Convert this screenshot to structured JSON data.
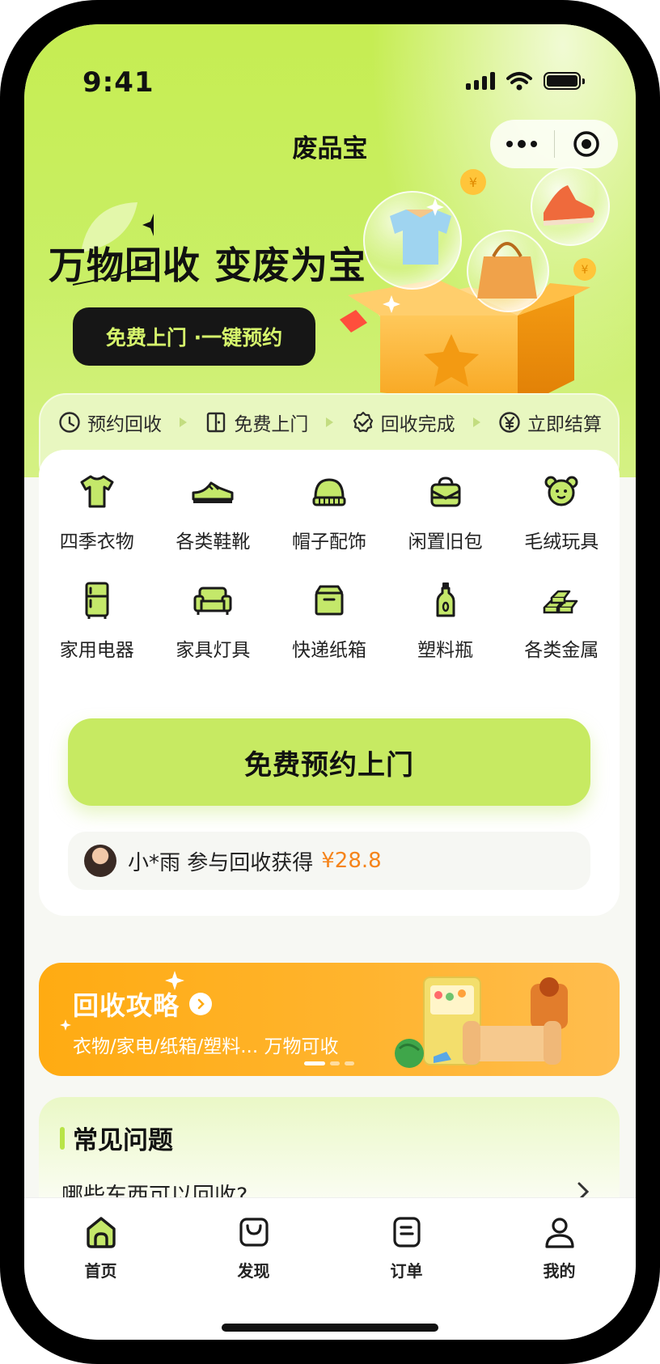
{
  "status_bar": {
    "time": "9:41",
    "icons": [
      "signal-icon",
      "wifi-icon",
      "battery-icon"
    ]
  },
  "nav": {
    "title": "废品宝",
    "capsule_icons": [
      "more-icon",
      "target-icon"
    ]
  },
  "hero": {
    "slogan": "万物回收 变废为宝",
    "cta": "免费上门 ·一键预约"
  },
  "steps": [
    {
      "icon": "clock-icon",
      "label": "预约回收"
    },
    {
      "icon": "door-icon",
      "label": "免费上门"
    },
    {
      "icon": "check-badge-icon",
      "label": "回收完成"
    },
    {
      "icon": "yen-icon",
      "label": "立即结算"
    }
  ],
  "categories": [
    {
      "icon": "tshirt-icon",
      "label": "四季衣物"
    },
    {
      "icon": "sneaker-icon",
      "label": "各类鞋靴"
    },
    {
      "icon": "hat-icon",
      "label": "帽子配饰"
    },
    {
      "icon": "bag-icon",
      "label": "闲置旧包"
    },
    {
      "icon": "bear-icon",
      "label": "毛绒玩具"
    },
    {
      "icon": "fridge-icon",
      "label": "家用电器"
    },
    {
      "icon": "sofa-icon",
      "label": "家具灯具"
    },
    {
      "icon": "box-icon",
      "label": "快递纸箱"
    },
    {
      "icon": "bottle-icon",
      "label": "塑料瓶"
    },
    {
      "icon": "metal-bars-icon",
      "label": "各类金属"
    }
  ],
  "book_button": "免费预约上门",
  "ticker": {
    "message": "小*雨 参与回收获得",
    "amount": "¥28.8"
  },
  "banner": {
    "title": "回收攻略",
    "subtitle": "衣物/家电/纸箱/塑料... 万物可收"
  },
  "faq": {
    "title": "常见问题",
    "first_question": "哪些东西可以回收?"
  },
  "tabs": [
    {
      "icon": "home-icon",
      "label": "首页"
    },
    {
      "icon": "shopping-bag-icon",
      "label": "发现"
    },
    {
      "icon": "order-icon",
      "label": "订单"
    },
    {
      "icon": "user-icon",
      "label": "我的"
    }
  ],
  "colors": {
    "accent": "#c7ea62",
    "banner": "#ffab12",
    "amount": "#f5841b",
    "dark": "#161616"
  }
}
